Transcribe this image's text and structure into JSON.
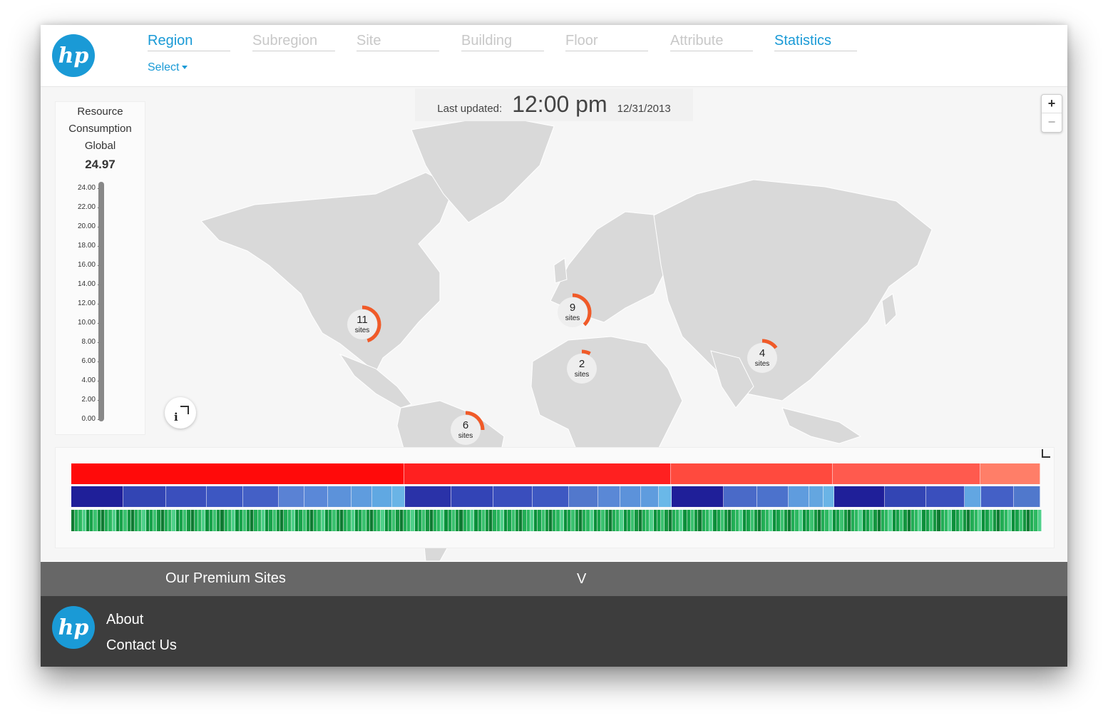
{
  "nav": {
    "tabs": [
      {
        "label": "Region",
        "active": true
      },
      {
        "label": "Subregion",
        "active": false
      },
      {
        "label": "Site",
        "active": false
      },
      {
        "label": "Building",
        "active": false
      },
      {
        "label": "Floor",
        "active": false
      },
      {
        "label": "Attribute",
        "active": false
      },
      {
        "label": "Statistics",
        "active": true
      }
    ],
    "select_label": "Select",
    "logo_text": "hp"
  },
  "map": {
    "last_updated_label": "Last updated:",
    "time": "12:00 pm",
    "date": "12/31/2013",
    "zoom_in": "+",
    "zoom_out": "−",
    "info_label": "i",
    "markers": [
      {
        "count": "11",
        "unit": "sites",
        "fill": 0.45
      },
      {
        "count": "9",
        "unit": "sites",
        "fill": 0.38
      },
      {
        "count": "2",
        "unit": "sites",
        "fill": 0.08
      },
      {
        "count": "4",
        "unit": "sites",
        "fill": 0.15
      },
      {
        "count": "6",
        "unit": "sites",
        "fill": 0.25
      }
    ]
  },
  "legend": {
    "title_line1": "Resource",
    "title_line2": "Consumption",
    "title_line3": "Global",
    "value": "24.97",
    "ticks": [
      "24.00",
      "22.00",
      "20.00",
      "18.00",
      "16.00",
      "14.00",
      "12.00",
      "10.00",
      "8.00",
      "6.00",
      "4.00",
      "2.00",
      "0.00"
    ]
  },
  "bars": {
    "red_segments": [
      {
        "weight": 468,
        "color": "#ff0a0a"
      },
      {
        "weight": 374,
        "color": "#ff2020"
      },
      {
        "weight": 227,
        "color": "#ff4a3e"
      },
      {
        "weight": 207,
        "color": "#ff5a4e"
      },
      {
        "weight": 83,
        "color": "#ff7e68"
      }
    ],
    "blue_segments": [
      {
        "weight": 74,
        "color": "#1f1f99"
      },
      {
        "weight": 60,
        "color": "#3345b4"
      },
      {
        "weight": 58,
        "color": "#3a4fbd"
      },
      {
        "weight": 51,
        "color": "#3d57c2"
      },
      {
        "weight": 50,
        "color": "#4460c6"
      },
      {
        "weight": 36,
        "color": "#5a82d4"
      },
      {
        "weight": 33,
        "color": "#5a88d8"
      },
      {
        "weight": 32,
        "color": "#5c92da"
      },
      {
        "weight": 29,
        "color": "#5f9cde"
      },
      {
        "weight": 28,
        "color": "#60a8e2"
      },
      {
        "weight": 17,
        "color": "#6ab4e6"
      },
      {
        "weight": 66,
        "color": "#2a32a8"
      },
      {
        "weight": 59,
        "color": "#3344b6"
      },
      {
        "weight": 55,
        "color": "#3a4ebd"
      },
      {
        "weight": 51,
        "color": "#3e58c2"
      },
      {
        "weight": 41,
        "color": "#5278cc"
      },
      {
        "weight": 31,
        "color": "#5a88d6"
      },
      {
        "weight": 29,
        "color": "#5c92da"
      },
      {
        "weight": 24,
        "color": "#5f9cde"
      },
      {
        "weight": 18,
        "color": "#6ab8e8"
      },
      {
        "weight": 74,
        "color": "#1f1f99"
      },
      {
        "weight": 47,
        "color": "#4a6ac8"
      },
      {
        "weight": 44,
        "color": "#4c72cc"
      },
      {
        "weight": 28,
        "color": "#5f9cde"
      },
      {
        "weight": 20,
        "color": "#64a6e0"
      },
      {
        "weight": 14,
        "color": "#6ab4e6"
      },
      {
        "weight": 72,
        "color": "#1f1f99"
      },
      {
        "weight": 58,
        "color": "#3345b4"
      },
      {
        "weight": 55,
        "color": "#3a4fbd"
      },
      {
        "weight": 22,
        "color": "#62a6e2"
      },
      {
        "weight": 46,
        "color": "#4460c6"
      },
      {
        "weight": 37,
        "color": "#5078cc"
      }
    ],
    "green_colors": [
      "#0b8f3a",
      "#17a24a",
      "#2cb860",
      "#4fd08a",
      "#0f7a32",
      "#22ad55",
      "#3cc270",
      "#14953f"
    ]
  },
  "accordion": {
    "title": "Our Premium Sites",
    "chevron": "V"
  },
  "footer": {
    "logo_text": "hp",
    "about": "About",
    "contact": "Contact Us"
  }
}
